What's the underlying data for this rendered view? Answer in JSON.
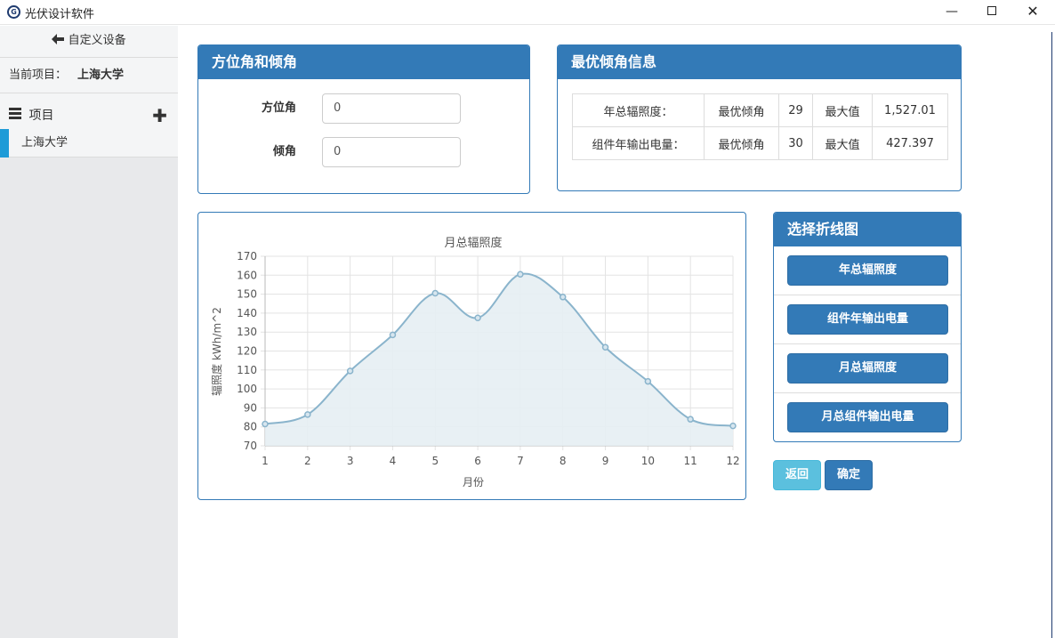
{
  "window": {
    "title": "光伏设计软件",
    "logo_text": "G",
    "min_glyph": "—",
    "close_glyph": "✕"
  },
  "sidebar": {
    "back_label": "自定义设备",
    "back_icon": "arrow-left-icon",
    "current_project_label": "当前项目：",
    "current_project_value": "上海大学",
    "items_header": "项目",
    "add_glyph": "✚",
    "items": [
      {
        "label": "上海大学"
      }
    ]
  },
  "angle_panel": {
    "title": "方位角和倾角",
    "azimuth_label": "方位角",
    "azimuth_value": "0",
    "tilt_label": "倾角",
    "tilt_value": "0"
  },
  "optimal_panel": {
    "title": "最优倾角信息",
    "rows": [
      {
        "name": "年总辐照度：",
        "opt_label": "最优倾角",
        "opt_value": "29",
        "max_label": "最大值",
        "max_value": "1,527.01"
      },
      {
        "name": "组件年输出电量：",
        "opt_label": "最优倾角",
        "opt_value": "30",
        "max_label": "最大值",
        "max_value": "427.397"
      }
    ]
  },
  "chart_data": {
    "type": "area",
    "title": "月总辐照度",
    "xlabel": "月份",
    "ylabel": "辐照度 kWh/m^2",
    "x": [
      1,
      2,
      3,
      4,
      5,
      6,
      7,
      8,
      9,
      10,
      11,
      12
    ],
    "series": [
      {
        "values": [
          81.5,
          86.5,
          109.5,
          128.5,
          150.5,
          137.5,
          160.5,
          148.5,
          122,
          104,
          84,
          80.5
        ]
      }
    ],
    "ylim": [
      70,
      170
    ],
    "yticks": [
      70,
      80,
      90,
      100,
      110,
      120,
      130,
      140,
      150,
      160,
      170
    ],
    "grid": true,
    "line_color": "#8ab4cc",
    "fill_color": "#e6eef3"
  },
  "chart_select_panel": {
    "title": "选择折线图",
    "buttons": [
      "年总辐照度",
      "组件年输出电量",
      "月总辐照度",
      "月总组件输出电量"
    ]
  },
  "actions": {
    "back_label": "返回",
    "ok_label": "确定"
  },
  "colors": {
    "primary": "#337ab7",
    "info": "#5bc0de",
    "sidebar_active": "#1e9bd7"
  }
}
